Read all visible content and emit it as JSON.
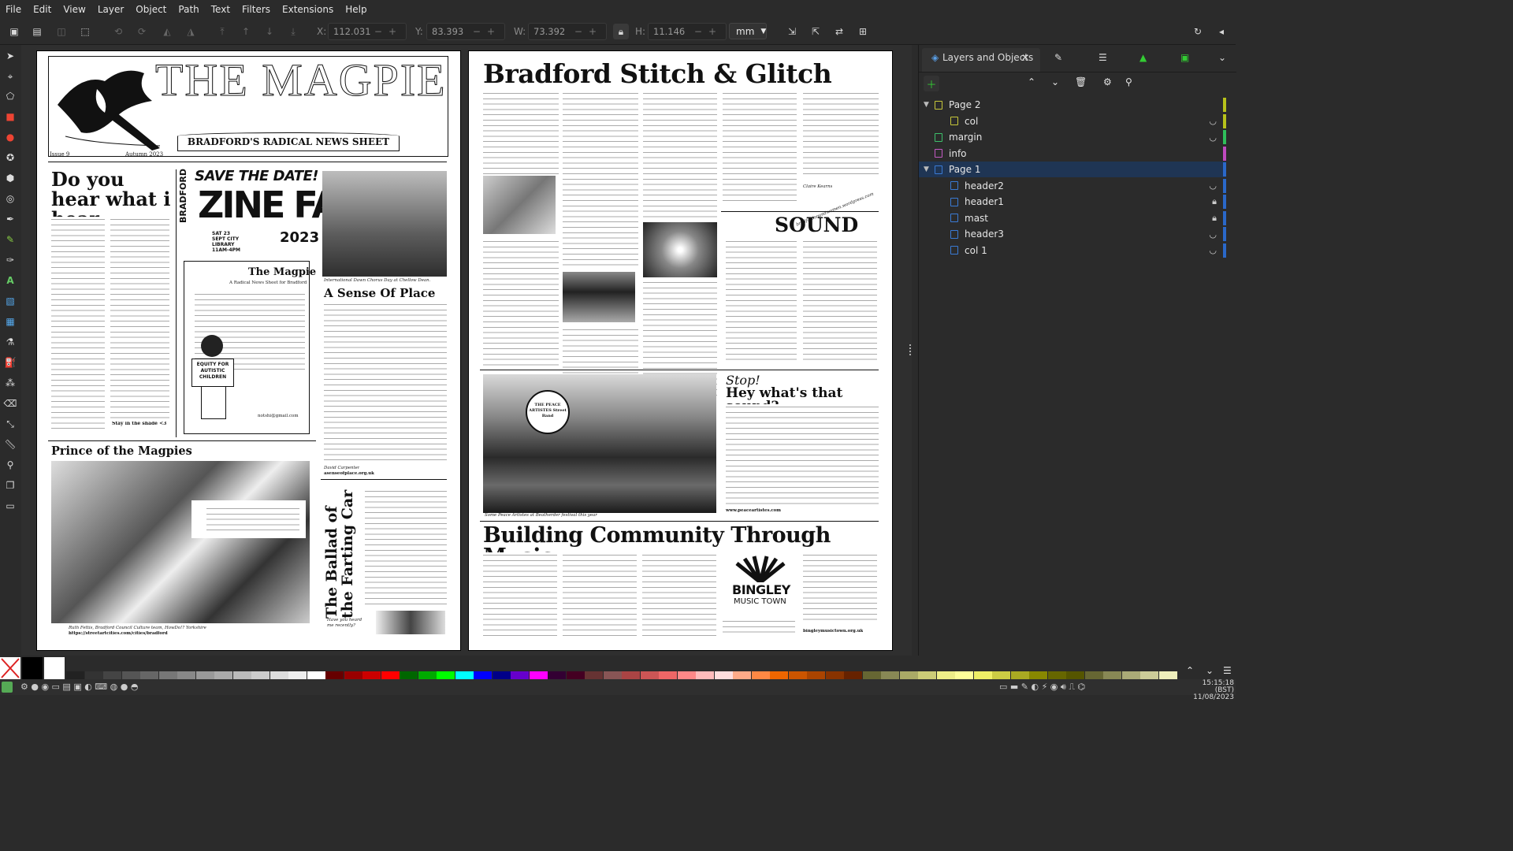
{
  "menu": [
    "File",
    "Edit",
    "View",
    "Layer",
    "Object",
    "Path",
    "Text",
    "Filters",
    "Extensions",
    "Help"
  ],
  "toolbar": {
    "x_label": "X:",
    "x_value": "112.031",
    "y_label": "Y:",
    "y_value": "83.393",
    "w_label": "W:",
    "w_value": "73.392",
    "h_label": "H:",
    "h_value": "11.146",
    "unit": "mm"
  },
  "panel": {
    "tab_title": "Layers and Objects",
    "layers": [
      {
        "name": "Page 2",
        "depth": 0,
        "expanded": true,
        "icon_color": "#c8c83a",
        "right": "",
        "bar": "#b7c21a"
      },
      {
        "name": "col",
        "depth": 1,
        "expanded": false,
        "icon_color": "#c8c83a",
        "right": "eye-closed",
        "bar": "#b7c21a"
      },
      {
        "name": "margin",
        "depth": 0,
        "expanded": false,
        "icon_color": "#3dc06a",
        "right": "eye-closed",
        "bar": "#2fbf5b"
      },
      {
        "name": "info",
        "depth": 0,
        "expanded": false,
        "icon_color": "#c45ac4",
        "right": "",
        "bar": "#c04ac0"
      },
      {
        "name": "Page 1",
        "depth": 0,
        "expanded": true,
        "icon_color": "#3a7bd5",
        "right": "",
        "bar": "#2a68c9",
        "selected": true
      },
      {
        "name": "header2",
        "depth": 1,
        "expanded": false,
        "icon_color": "#3a7bd5",
        "right": "eye-closed",
        "bar": "#2a68c9"
      },
      {
        "name": "header1",
        "depth": 1,
        "expanded": false,
        "icon_color": "#3a7bd5",
        "right": "lock",
        "bar": "#2a68c9"
      },
      {
        "name": "mast",
        "depth": 1,
        "expanded": false,
        "icon_color": "#3a7bd5",
        "right": "lock",
        "bar": "#2a68c9"
      },
      {
        "name": "header3",
        "depth": 1,
        "expanded": false,
        "icon_color": "#3a7bd5",
        "right": "eye-closed",
        "bar": "#2a68c9"
      },
      {
        "name": "col 1",
        "depth": 1,
        "expanded": false,
        "icon_color": "#3a7bd5",
        "right": "eye-closed",
        "bar": "#2a68c9"
      }
    ]
  },
  "page1": {
    "masthead": "THE MAGPIE",
    "strapline": "BRADFORD'S RADICAL NEWS SHEET",
    "issue": "Issue 9",
    "season": "Autumn 2023",
    "h_doyouhear": "Do you hear what i hear",
    "save_date": "SAVE THE DATE!",
    "zine": "ZINE FAIR",
    "bradford": "BRADFORD",
    "zine_year": "2023",
    "zine_when": "SAT 23 SEPT CITY LIBRARY 11AM-4PM",
    "magpie_box_title": "The Magpie",
    "magpie_box_sub": "A Radical News Sheet for Bradford",
    "equity": "EQUITY FOR AUTISTIC CHILDREN",
    "photo_caption": "International Dawn Chorus Day at Chellow Dean.",
    "h_sense": "A Sense Of Place",
    "sense_credit": "David Carpenter",
    "sense_url": "asenseofplace.org.uk",
    "h_prince": "Prince of the Magpies",
    "prince_credit": "Ruth Fettis, Bradford Council Culture team, HowDo!? Yorkshire",
    "prince_url": "https://streetartcities.com/cities/bradford",
    "h_ballad": "The Ballad of the Farting Car",
    "stay_shade": "Stay in the shade <3",
    "contact_email": "notshi@gmail.com",
    "have_you_heard": "Have you heard me recently?"
  },
  "page2": {
    "h_main": "Bradford Stitch & Glitch",
    "h_sound": "SOUND",
    "h_stop": "Stop!",
    "h_hey": "Hey what's that sound?",
    "h_building": "Building Community Through Music",
    "peace_caption": "Some Peace Artistes at Beatherder festival this year",
    "peace_url": "www.peaceartistes.com",
    "bingley": "BINGLEY",
    "music_town": "MUSIC TOWN",
    "bingley_url": "bingleymusictown.org.uk",
    "claire": "Claire Kearns",
    "wordpress": "bradfordsoundwomen.wordpress.com",
    "peace_artistes": "THE PEACE ARTISTES Street Band"
  },
  "clock": {
    "time": "15:15:18 (BST)",
    "date": "11/08/2023"
  }
}
